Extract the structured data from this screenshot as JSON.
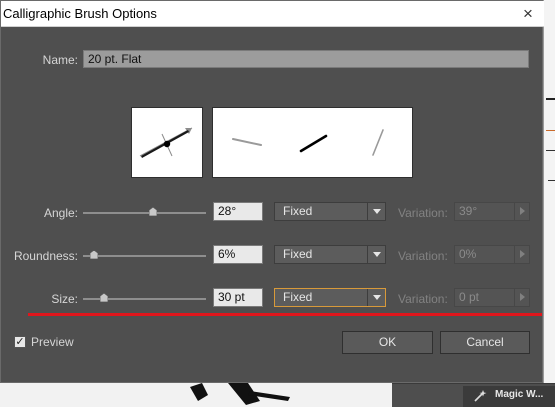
{
  "dialog": {
    "title": "Calligraphic Brush Options",
    "close_glyph": "×"
  },
  "name": {
    "label": "Name:",
    "value": "20 pt. Flat"
  },
  "angle": {
    "label": "Angle:",
    "value": "28°",
    "slider_level": 0.56,
    "mode": "Fixed",
    "variation_label": "Variation:",
    "variation_value": "39°"
  },
  "roundness": {
    "label": "Roundness:",
    "value": "6%",
    "slider_level": 0.06,
    "mode": "Fixed",
    "variation_label": "Variation:",
    "variation_value": "0%"
  },
  "size": {
    "label": "Size:",
    "value": "30 pt",
    "slider_level": 0.15,
    "mode": "Fixed",
    "variation_label": "Variation:",
    "variation_value": "0 pt"
  },
  "preview": {
    "label": "Preview",
    "checked": true,
    "check_glyph": "✓"
  },
  "buttons": {
    "ok": "OK",
    "cancel": "Cancel"
  },
  "background": {
    "panel_tab_label": "Magic W..."
  },
  "colors": {
    "dialog_bg": "#4f4f4f",
    "annotation_line": "#e0161c",
    "focus_border": "#d89a3a"
  },
  "icons": {
    "dropdown": "chevron-down-icon",
    "variation": "triangle-right-icon",
    "wand": "magic-wand-icon"
  }
}
